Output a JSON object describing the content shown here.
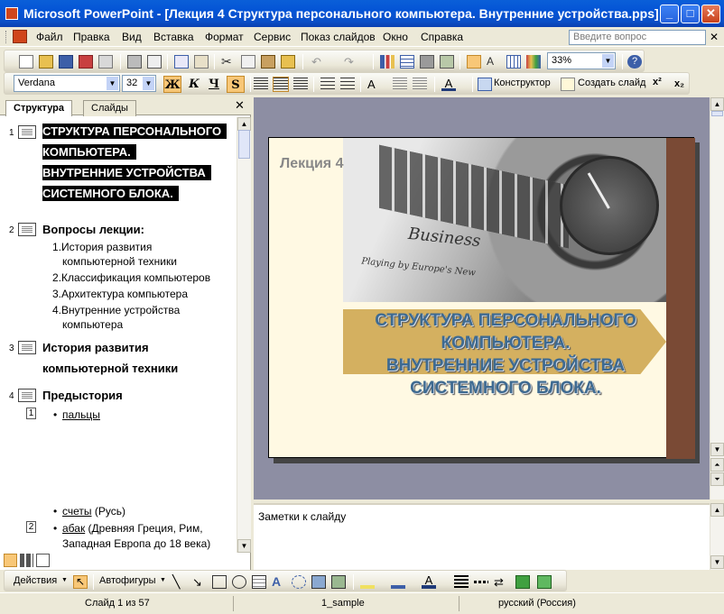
{
  "window": {
    "title": "Microsoft PowerPoint - [Лекция 4 Структура персонального компьютера. Внутренние устройства.pps]"
  },
  "menu": {
    "items": [
      "Файл",
      "Правка",
      "Вид",
      "Вставка",
      "Формат",
      "Сервис",
      "Показ слайдов",
      "Окно",
      "Справка"
    ],
    "help_placeholder": "Введите вопрос"
  },
  "standard_toolbar": {
    "zoom": "33%"
  },
  "format_toolbar": {
    "font": "Verdana",
    "size": "32",
    "bold": "Ж",
    "italic": "К",
    "underline": "Ч",
    "shadow": "S",
    "designer": "Конструктор",
    "new_slide": "Создать слайд"
  },
  "left_pane": {
    "tabs": [
      "Структура",
      "Слайды"
    ],
    "slides": [
      {
        "num": "1",
        "title_lines": [
          "СТРУКТУРА ПЕРСОНАЛЬНОГО",
          "КОМПЬЮТЕРА.",
          "ВНУТРЕННИЕ УСТРОЙСТВА",
          "СИСТЕМНОГО БЛОКА."
        ]
      },
      {
        "num": "2",
        "title": "Вопросы лекции:",
        "items": [
          "1.История развития",
          "компьютерной техники",
          "2.Классификация компьютеров",
          "3.Архитектура компьютера",
          "4.Внутренние  устройства",
          "компьютера"
        ]
      },
      {
        "num": "3",
        "title_lines": [
          "История развития",
          "компьютерной техники"
        ]
      },
      {
        "num": "4",
        "title": "Предыстория",
        "box1": "1",
        "bullet1": "пальцы",
        "bullet2_link": "счеты",
        "bullet2_rest": " (Русь)",
        "box2": "2",
        "bullet3_link": "абак",
        "bullet3_rest": " (Древняя Греция, Рим,",
        "bullet3_line2": "Западная Европа до 18 века)"
      }
    ]
  },
  "slide": {
    "lecture_label": "Лекция 4",
    "title_lines": [
      "СТРУКТУРА ПЕРСОНАЛЬНОГО",
      "КОМПЬЮТЕРА.",
      "ВНУТРЕННИЕ УСТРОЙСТВА",
      "СИСТЕМНОГО БЛОКА."
    ],
    "image_texts": {
      "business": "Business",
      "playing": "Playing by Europe's New"
    }
  },
  "notes": {
    "placeholder": "Заметки к слайду"
  },
  "drawing_toolbar": {
    "actions": "Действия",
    "autoshapes": "Автофигуры"
  },
  "status": {
    "slide": "Слайд 1 из 57",
    "design": "1_sample",
    "language": "русский (Россия)"
  },
  "colors": {
    "accent": "#0a5fd8",
    "slide_bg": "#fff9e3",
    "slide_band": "#7a4a35",
    "title_text": "#3e6a91"
  }
}
